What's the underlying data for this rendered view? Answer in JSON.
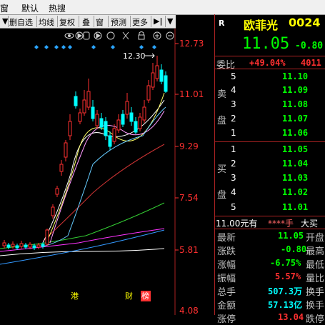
{
  "menu": {
    "items": [
      "窗",
      "默认",
      "热搜"
    ]
  },
  "toolbar": {
    "buttons": [
      "删自选",
      "均线",
      "复权",
      "叠",
      "窗",
      "预测",
      "更多"
    ],
    "arrow_icon": "▶|",
    "dropdown_icon": "▼"
  },
  "chart_tools": [
    "eye-icon",
    "circle-play-icon",
    "hand-icon",
    "play-icon",
    "circle-icon",
    "scissors-icon",
    "lock-icon",
    "zoom-in-icon",
    "zoom-out-icon"
  ],
  "chart_data": {
    "type": "candlestick",
    "y_axis_labels": [
      "12.73",
      "11.01",
      "9.29",
      "7.54",
      "5.81",
      "4.08"
    ],
    "max_annotation": "12.30",
    "event_markers": [
      "港",
      "财",
      "榜"
    ],
    "colors": {
      "up": "#ff3030",
      "down": "#00ffff",
      "grid": "#aa2222",
      "axis_text": "#ff3030"
    }
  },
  "quote": {
    "badge": "R",
    "name": "欧菲光",
    "code": "0024",
    "price": "11.05",
    "change": "-0.80",
    "weibi_label": "委比",
    "weibi_value": "+49.04%",
    "weibi_diff": "4011",
    "sell_label": [
      "卖",
      "盘"
    ],
    "buy_label": [
      "买",
      "盘"
    ],
    "sell": [
      {
        "level": "5",
        "price": "11.10"
      },
      {
        "level": "4",
        "price": "11.09"
      },
      {
        "level": "3",
        "price": "11.08"
      },
      {
        "level": "2",
        "price": "11.07"
      },
      {
        "level": "1",
        "price": "11.06"
      }
    ],
    "buy": [
      {
        "level": "1",
        "price": "11.05"
      },
      {
        "level": "2",
        "price": "11.04"
      },
      {
        "level": "3",
        "price": "11.03"
      },
      {
        "level": "4",
        "price": "11.02"
      },
      {
        "level": "5",
        "price": "11.01"
      }
    ],
    "status_price": "11.00元有",
    "status_hand": "****手",
    "status_right": "大买",
    "stats": [
      {
        "label": "最新",
        "value": "11.05",
        "right": "开盘"
      },
      {
        "label": "涨跌",
        "value": "-0.80",
        "right": "最高"
      },
      {
        "label": "涨幅",
        "value": "-6.75%",
        "right": "最低"
      },
      {
        "label": "振幅",
        "value": "5.57%",
        "right": "量比"
      },
      {
        "label": "总手",
        "value": "507.3万",
        "right": "换手"
      },
      {
        "label": "金额",
        "value": "57.13亿",
        "right": "换手"
      },
      {
        "label": "涨停",
        "value": "13.04",
        "right": "跌停"
      }
    ]
  }
}
